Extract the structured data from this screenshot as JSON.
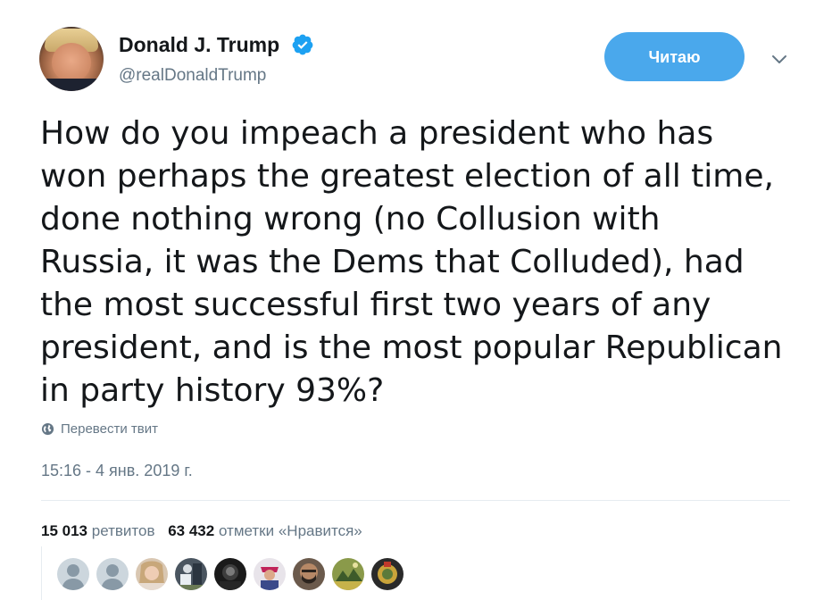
{
  "author": {
    "display_name": "Donald J. Trump",
    "handle": "@realDonaldTrump",
    "avatar_icon": "profile-photo",
    "verified_icon": "verified-badge-icon"
  },
  "follow_button": {
    "label": "Читаю"
  },
  "menu_icon": "chevron-down-icon",
  "tweet": {
    "text": "How do you impeach a president who has\nwon perhaps the greatest election of all time,\ndone nothing wrong (no Collusion with\nRussia, it was the Dems that Colluded), had\nthe most successful first two years of any\npresident, and is the most popular Republican\nin party history 93%?",
    "translate_label": "Перевести твит",
    "timestamp": "15:16 - 4 янв. 2019 г."
  },
  "stats": {
    "retweets_count": "15 013",
    "retweets_label": "ретвитов",
    "likes_count": "63 432",
    "likes_label": "отметки «Нравится»"
  },
  "colors": {
    "accent": "#4aa8ec",
    "text": "#14171a",
    "secondary_text": "#657786",
    "divider": "#e6ecf0"
  }
}
